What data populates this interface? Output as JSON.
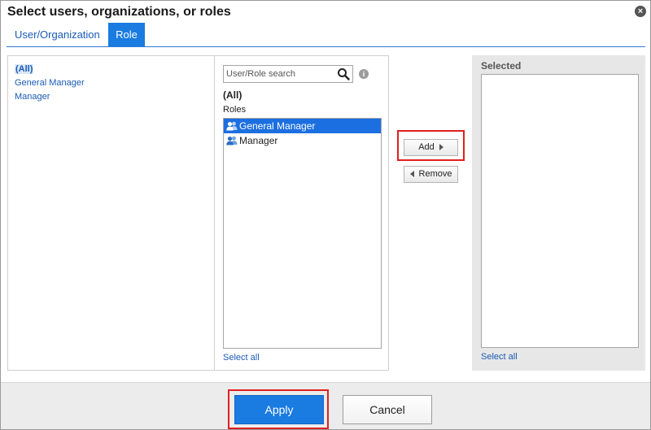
{
  "dialog": {
    "title": "Select users, organizations, or roles"
  },
  "tabs": [
    {
      "label": "User/Organization",
      "active": false
    },
    {
      "label": "Role",
      "active": true
    }
  ],
  "org_tree": {
    "items": [
      "(All)",
      "General Manager",
      "Manager"
    ],
    "selected": "(All)"
  },
  "roles_pane": {
    "search_placeholder": "User/Role search",
    "heading": "(All)",
    "list_label": "Roles",
    "items": [
      {
        "label": "General Manager",
        "selected": true
      },
      {
        "label": "Manager",
        "selected": false
      }
    ],
    "select_all": "Select all"
  },
  "transfer": {
    "add_label": "Add",
    "remove_label": "Remove"
  },
  "selected_pane": {
    "label": "Selected",
    "select_all": "Select all"
  },
  "footer": {
    "apply_label": "Apply",
    "cancel_label": "Cancel"
  },
  "colors": {
    "accent": "#1a7be0",
    "link": "#1a5bb5",
    "highlight_box": "#e01f1f"
  },
  "icons": {
    "close": "close-icon",
    "search": "search-icon",
    "info": "info-icon",
    "role": "role-group-icon"
  }
}
